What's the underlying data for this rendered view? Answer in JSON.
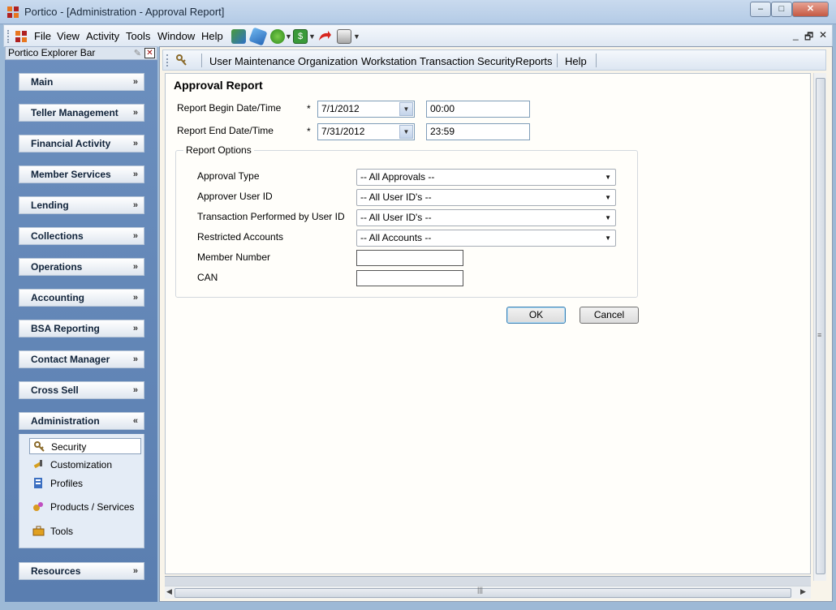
{
  "window": {
    "title": "Portico - [Administration - Approval Report]",
    "minimize": "–",
    "maximize": "□",
    "close": "✕"
  },
  "menubar": {
    "items": [
      "File",
      "View",
      "Activity",
      "Tools",
      "Window",
      "Help"
    ],
    "mdi_controls": [
      "_",
      "🗗",
      "✕"
    ],
    "toolbar_icons": [
      "switch-icon",
      "tag-icon",
      "money-icon",
      "dollar-bill-icon",
      "redo-arrow-icon",
      "printer-icon"
    ]
  },
  "explorer": {
    "title": "Portico Explorer Bar",
    "groups": [
      {
        "label": "Main"
      },
      {
        "label": "Teller Management"
      },
      {
        "label": "Financial Activity"
      },
      {
        "label": "Member Services"
      },
      {
        "label": "Lending"
      },
      {
        "label": "Collections"
      },
      {
        "label": "Operations"
      },
      {
        "label": "Accounting"
      },
      {
        "label": "BSA Reporting"
      },
      {
        "label": "Contact Manager"
      },
      {
        "label": "Cross Sell"
      },
      {
        "label": "Administration"
      },
      {
        "label": "Resources"
      }
    ],
    "admin_items": [
      {
        "label": "Security",
        "icon": "keys-icon",
        "selected": true
      },
      {
        "label": "Customization",
        "icon": "tools-icon"
      },
      {
        "label": "Profiles",
        "icon": "profiles-icon"
      },
      {
        "label": "Products / Services",
        "icon": "products-icon"
      },
      {
        "label": "Tools",
        "icon": "toolbox-icon"
      }
    ]
  },
  "module_menu": {
    "items": [
      "User Maintenance",
      "Organization",
      "Workstation",
      "Transaction Security",
      "Reports",
      "Help"
    ]
  },
  "form": {
    "title": "Approval Report",
    "begin": {
      "label": "Report Begin Date/Time",
      "required": "*",
      "date": "7/1/2012",
      "time": "00:00"
    },
    "end": {
      "label": "Report End Date/Time",
      "required": "*",
      "date": "7/31/2012",
      "time": "23:59"
    },
    "options": {
      "legend": "Report Options",
      "approval_type": {
        "label": "Approval Type",
        "value": "-- All Approvals --"
      },
      "approver_user_id": {
        "label": "Approver User ID",
        "value": "-- All User ID's --"
      },
      "performed_by": {
        "label": "Transaction Performed by User ID",
        "value": "-- All User ID's --"
      },
      "restricted_accounts": {
        "label": "Restricted Accounts",
        "value": "-- All Accounts --"
      },
      "member_number": {
        "label": "Member Number",
        "value": ""
      },
      "can": {
        "label": "CAN",
        "value": ""
      }
    },
    "ok": "OK",
    "cancel": "Cancel"
  },
  "colors": {
    "accent": "#5a7eb0",
    "panel": "#fffefa"
  }
}
